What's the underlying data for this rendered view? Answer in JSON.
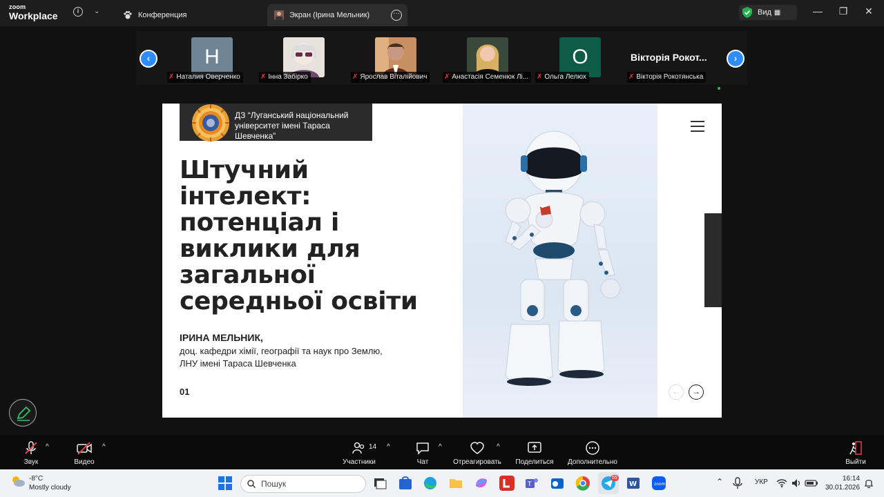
{
  "app": {
    "logo_top": "zoom",
    "logo_bottom": "Workplace"
  },
  "tabs": [
    {
      "label": "Конференция"
    },
    {
      "label": "Экран (Ірина Мельник)"
    }
  ],
  "view_button": {
    "label": "Вид"
  },
  "gallery": {
    "participants": [
      {
        "name": "Наталия Оверченко",
        "initial": "Н",
        "type": "letter"
      },
      {
        "name": "Інна Забірко",
        "type": "photo"
      },
      {
        "name": "Ярослав Віталійович",
        "type": "photo"
      },
      {
        "name": "Анастасія Семенюк Лі...",
        "type": "photo"
      },
      {
        "name": "Ольга Лелюх",
        "initial": "О",
        "type": "letter"
      },
      {
        "name": "Вікторія Рокотянська",
        "display": "Вікторія Рокот...",
        "type": "text"
      }
    ]
  },
  "slide": {
    "university": "ДЗ “Луганський національний університет імені Тараса Шевченка”",
    "title": "Штучний інтелект: потенціал і виклики для загальної середньої освіти",
    "author_name": "ІРИНА МЕЛЬНИК,",
    "author_line1": "доц. кафедри хімії, географії та наук про Землю,",
    "author_line2": "ЛНУ імені Тараса Шевченка",
    "page": "01"
  },
  "toolbar": {
    "audio": "Звук",
    "video": "Видео",
    "participants": "Участники",
    "participants_count": "14",
    "chat": "Чат",
    "react": "Отреагировать",
    "share": "Поделиться",
    "more": "Дополнительно",
    "leave": "Выйти"
  },
  "taskbar": {
    "temperature": "-8°C",
    "weather": "Mostly cloudy",
    "search_placeholder": "Пошук",
    "language": "УКР",
    "time": "16:14",
    "date": "30.01.2026",
    "telegram_badge": "55"
  },
  "colors": {
    "zoom_blue": "#2d8cff",
    "muted_red": "#e34444",
    "slide_dark": "#2b2b2b"
  }
}
